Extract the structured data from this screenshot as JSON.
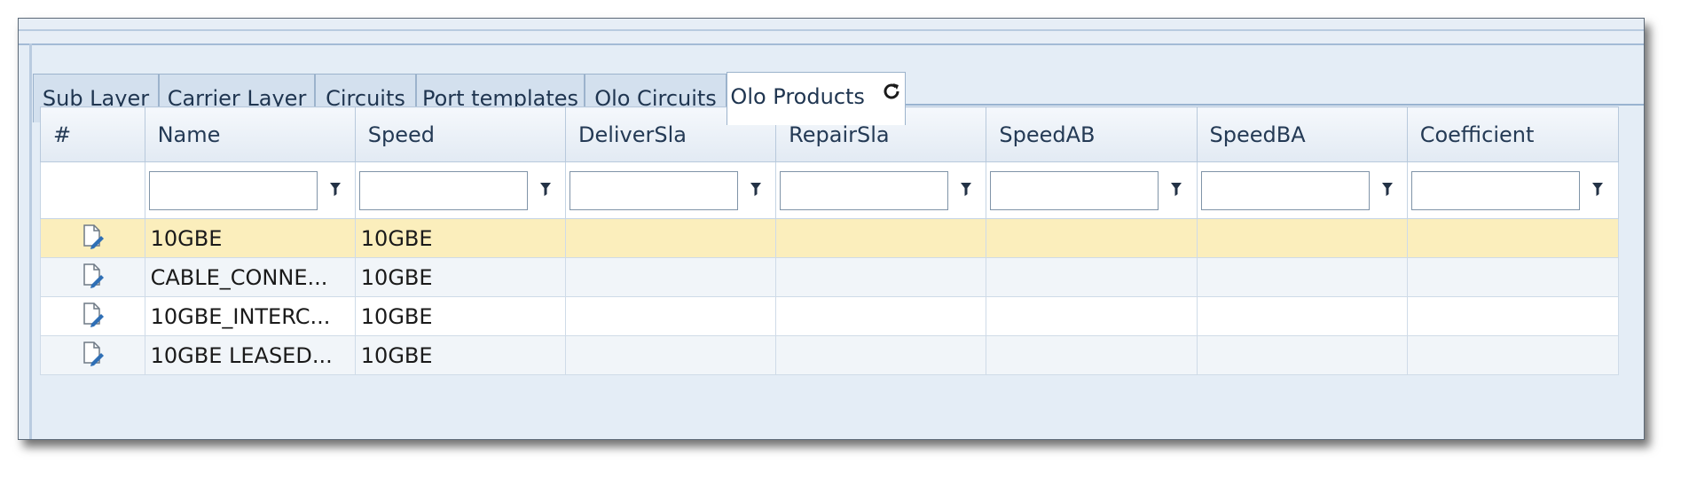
{
  "tabs": [
    {
      "label": "Sub Layer",
      "active": false
    },
    {
      "label": "Carrier Layer",
      "active": false
    },
    {
      "label": "Circuits",
      "active": false
    },
    {
      "label": "Port templates",
      "active": false
    },
    {
      "label": "Olo Circuits",
      "active": false
    },
    {
      "label": "Olo Products",
      "active": true
    }
  ],
  "grid": {
    "columns": [
      "#",
      "Name",
      "Speed",
      "DeliverSla",
      "RepairSla",
      "SpeedAB",
      "SpeedBA",
      "Coefficient"
    ],
    "rows": [
      {
        "name": "10GBE",
        "speed": "10GBE",
        "selected": true
      },
      {
        "name": "CABLE_CONNE...",
        "speed": "10GBE"
      },
      {
        "name": "10GBE_INTERC...",
        "speed": "10GBE"
      },
      {
        "name": "10GBE LEASED...",
        "speed": "10GBE"
      }
    ]
  },
  "colors": {
    "selected_row": "#fbeebc",
    "header_text": "#243a55",
    "tab_bg": "#d3e0ee"
  },
  "icons": {
    "tab_refresh": "refresh-icon",
    "filter": "funnel-icon",
    "row_edit": "edit-document-icon"
  }
}
